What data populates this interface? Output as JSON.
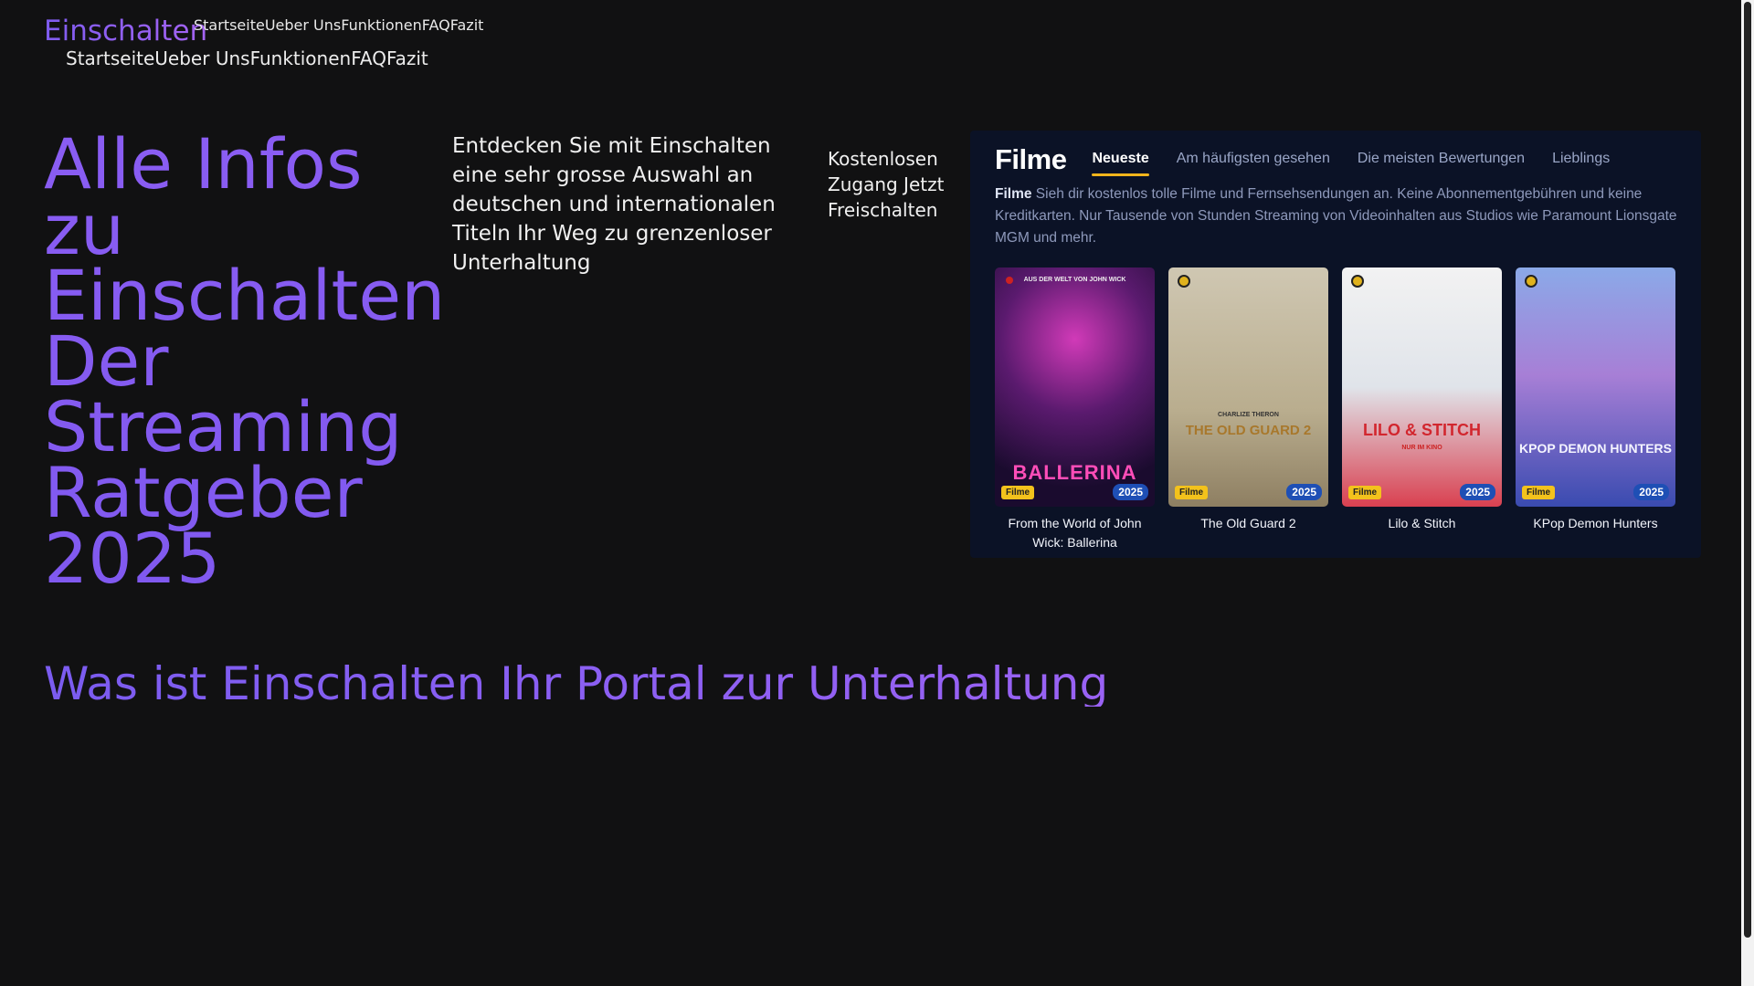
{
  "header": {
    "logo": "Einschalten",
    "nav": [
      "Startseite",
      "Ueber Uns",
      "Funktionen",
      "FAQ",
      "Fazit"
    ]
  },
  "hero": {
    "title": "Alle Infos zu Einschalten Der Streaming Ratgeber 2025",
    "description": "Entdecken Sie mit Einschalten eine sehr grosse Auswahl an deutschen und internationalen Titeln Ihr Weg zu grenzenloser Unterhaltung",
    "cta": "Kostenlosen Zugang Jetzt Freischalten"
  },
  "panel": {
    "title": "Filme",
    "tabs": [
      "Neueste",
      "Am häufigsten gesehen",
      "Die meisten Bewertungen",
      "Lieblings"
    ],
    "desc_bold": "Filme",
    "desc": "Sieh dir kostenlos tolle Filme und Fernsehsendungen an. Keine Abonnementgebühren und keine Kreditkarten. Nur Tausende von Stunden Streaming von Videoinhalten aus Studios wie Paramount Lionsgate MGM und mehr.",
    "cards": [
      {
        "title": "From the World of John Wick: Ballerina",
        "category": "Filme",
        "year": "2025",
        "poster_text": "BALLERINA",
        "poster_top": "AUS DER WELT VON JOHN WICK"
      },
      {
        "title": "The Old Guard 2",
        "category": "Filme",
        "year": "2025",
        "poster_text": "THE OLD GUARD 2",
        "poster_top": "CHARLIZE THERON"
      },
      {
        "title": "Lilo & Stitch",
        "category": "Filme",
        "year": "2025",
        "poster_text": "LILO & STITCH",
        "poster_top": "NUR IM KINO"
      },
      {
        "title": "KPop Demon Hunters",
        "category": "Filme",
        "year": "2025",
        "poster_text": "KPOP DEMON HUNTERS",
        "poster_top": ""
      }
    ],
    "colors": {
      "bg": "#0b1226",
      "accent": "#f1b51c",
      "year_badge": "#1e4fb5"
    }
  },
  "section": {
    "title": "Was ist Einschalten Ihr Portal zur Unterhaltung"
  },
  "colors": {
    "background": "#111112",
    "brand": "#8a5cf2"
  }
}
